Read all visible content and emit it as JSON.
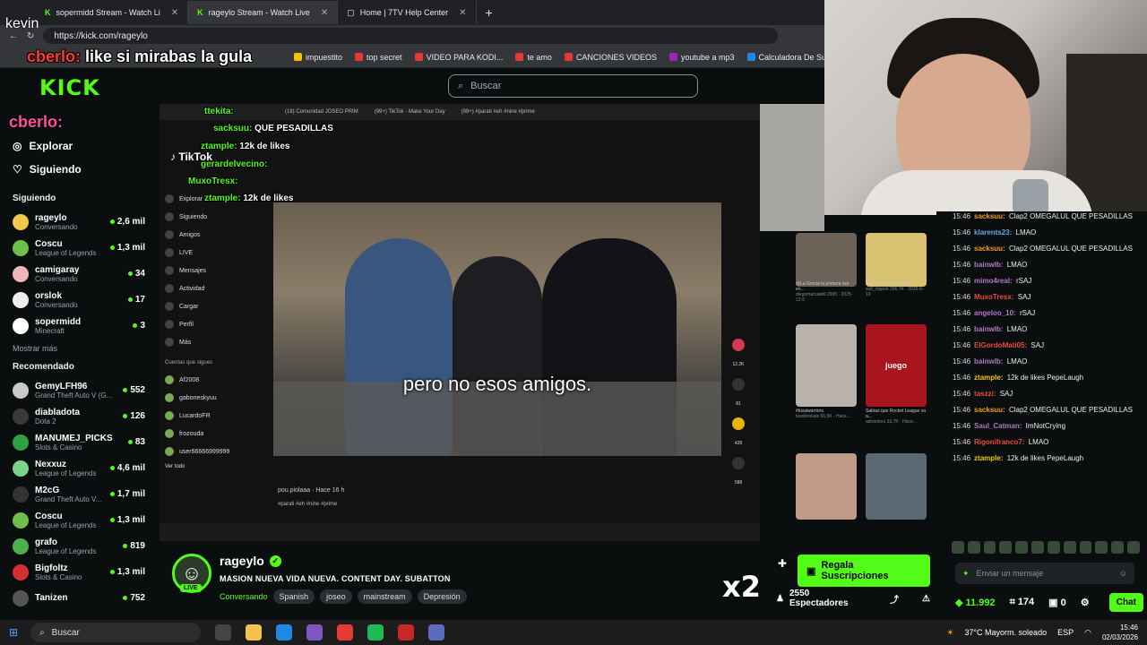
{
  "browser": {
    "tabs": [
      {
        "label": "sopermidd Stream - Watch Li"
      },
      {
        "label": "rageylo Stream - Watch Live"
      },
      {
        "label": "Home | 7TV Help Center"
      }
    ],
    "url": "https://kick.com/rageylo",
    "bookmarks": [
      "impuestito",
      "top secret",
      "VIDEO PARA KODI...",
      "te amo",
      "CANCIONES VIDEOS",
      "youtube a mp3",
      "Calculadora De Su..."
    ]
  },
  "kick": {
    "logo": "KICK",
    "search_placeholder": "Buscar",
    "nav": {
      "explore": "Explorar",
      "following": "Siguiendo"
    },
    "following_title": "Siguiendo",
    "following": [
      {
        "name": "rageylo",
        "cat": "Conversando",
        "viewers": "2,6 mil",
        "color": "#f2c94c"
      },
      {
        "name": "Coscu",
        "cat": "League of Legends",
        "viewers": "1,3 mil",
        "color": "#6fbf4a"
      },
      {
        "name": "camigaray",
        "cat": "Conversando",
        "viewers": "34",
        "color": "#f3b6b6"
      },
      {
        "name": "orslok",
        "cat": "Conversando",
        "viewers": "17",
        "color": "#eeeeee"
      },
      {
        "name": "sopermidd",
        "cat": "Minecraft",
        "viewers": "3",
        "color": "#ffffff"
      }
    ],
    "show_more": "Mostrar más",
    "recommended_title": "Recomendado",
    "recommended": [
      {
        "name": "GemyLFH96",
        "cat": "Grand Theft Auto V (G...",
        "viewers": "552",
        "color": "#c9c9c9"
      },
      {
        "name": "diabladota",
        "cat": "Dota 2",
        "viewers": "126",
        "color": "#3a3a3a"
      },
      {
        "name": "MANUMEJ_PICKS",
        "cat": "Slots & Casino",
        "viewers": "83",
        "color": "#2f9e44"
      },
      {
        "name": "Nexxuz",
        "cat": "League of Legends",
        "viewers": "4,6 mil",
        "color": "#7bd389"
      },
      {
        "name": "M2cG",
        "cat": "Grand Theft Auto V...",
        "viewers": "1,7 mil",
        "color": "#333333"
      },
      {
        "name": "Coscu",
        "cat": "League of Legends",
        "viewers": "1,3 mil",
        "color": "#6fbf4a"
      },
      {
        "name": "grafo",
        "cat": "League of Legends",
        "viewers": "819",
        "color": "#4caf50"
      },
      {
        "name": "Bigfoltz",
        "cat": "Slots & Casino",
        "viewers": "1,3 mil",
        "color": "#d32f2f"
      },
      {
        "name": "Tanizen",
        "cat": "",
        "viewers": "752",
        "color": "#555555"
      }
    ]
  },
  "video": {
    "inner_tabs": [
      "(18) Comunidad JOSEO PRIM",
      "(99+) TikTok - Make Your Day",
      "(99+) #parati #eh #nine #prime"
    ],
    "tiktok_logo": "TikTok",
    "tiktok_nav": [
      "Explorar",
      "Siguiendo",
      "Amigos",
      "LIVE",
      "Mensajes",
      "Actividad",
      "Cargar",
      "Perfil",
      "Más"
    ],
    "following_accounts_title": "Cuentas que sigues",
    "following_accounts": [
      "Af2008",
      "gaboneskyuu",
      "LucardoFR",
      "frozouda",
      "user66666999999"
    ],
    "see_all": "Ver todo",
    "caption": "pero no esos amigos.",
    "uploader": "pou.piolaaa · Hace 16 h",
    "hashtags": "#parati #eh #nine #prime",
    "side_counts": [
      "12.2K",
      "81",
      "428",
      "588"
    ],
    "thumbs": [
      {
        "label": "@La Grecia la primera vez en...",
        "meta": "diegomarcatelli  2905 · 2025-12-5"
      },
      {
        "label": "tum_tum paaa #paratii...",
        "meta": "sofi_nippon  296,7K · 2025-9-10"
      },
      {
        "label": "#tussiwarriors",
        "meta": "tussitonkais  56,5K · Hace..."
      },
      {
        "label": "Sabías que Rocket League va a...",
        "meta": "adriantors  33,7K · Hace..."
      }
    ],
    "thumb_word": "juego"
  },
  "overlays": {
    "kevin": "kevin",
    "top_name": "cberlo:",
    "top_text": "like si mirabas la gula",
    "mid": "cberlo:",
    "screen_chat": [
      {
        "user": "ttekita:",
        "text": ""
      },
      {
        "user": "sacksuu:",
        "text": "QUE PESADILLAS"
      },
      {
        "user": "ztample:",
        "text": "12k de likes"
      },
      {
        "user": "gerardelvecino:",
        "text": ""
      },
      {
        "user": "MuxoTresx:",
        "text": ""
      },
      {
        "user": "ztample:",
        "text": "12k de likes"
      }
    ],
    "x2": "x2"
  },
  "chat": {
    "messages": [
      {
        "time": "15:46",
        "user": "sacksuu:",
        "text": "Clap2 OMEGALUL QUE PESADILLAS",
        "color": "#f39c12"
      },
      {
        "time": "15:46",
        "user": "klarents23:",
        "text": "LMAO",
        "color": "#5dade2"
      },
      {
        "time": "15:46",
        "user": "sacksuu:",
        "text": "Clap2 OMEGALUL QUE PESADILLAS",
        "color": "#f39c12"
      },
      {
        "time": "15:46",
        "user": "bainwlb:",
        "text": "LMAO",
        "color": "#af7ac5"
      },
      {
        "time": "15:46",
        "user": "mimo4real:",
        "text": "rSAJ",
        "color": "#af7ac5"
      },
      {
        "time": "15:46",
        "user": "MuxoTresx:",
        "text": "SAJ",
        "color": "#e74c3c"
      },
      {
        "time": "15:46",
        "user": "angeloo_10:",
        "text": "rSAJ",
        "color": "#af7ac5"
      },
      {
        "time": "15:46",
        "user": "bainwlb:",
        "text": "LMAO",
        "color": "#af7ac5"
      },
      {
        "time": "15:46",
        "user": "ElGordoMati05:",
        "text": "SAJ",
        "color": "#e74c3c"
      },
      {
        "time": "15:46",
        "user": "bainwlb:",
        "text": "LMAO",
        "color": "#af7ac5"
      },
      {
        "time": "15:46",
        "user": "ztample:",
        "text": "12k de likes PepeLaugh",
        "color": "#f1c40f"
      },
      {
        "time": "15:46",
        "user": "taszzi:",
        "text": "SAJ",
        "color": "#e74c3c"
      },
      {
        "time": "15:46",
        "user": "sacksuu:",
        "text": "Clap2 OMEGALUL QUE PESADILLAS",
        "color": "#f39c12"
      },
      {
        "time": "15:46",
        "user": "Saul_Catman:",
        "text": "ImNotCrying",
        "color": "#af7ac5"
      },
      {
        "time": "15:46",
        "user": "Rigonifranco7:",
        "text": "LMAO",
        "color": "#e74c3c"
      },
      {
        "time": "15:46",
        "user": "ztample:",
        "text": "12k de likes PepeLaugh",
        "color": "#f1c40f"
      }
    ],
    "input_placeholder": "Enviar un mensaje",
    "points": "11.992",
    "count": "174",
    "zero": "0",
    "chat_button": "Chat"
  },
  "channel": {
    "name": "rageylo",
    "live": "LIVE",
    "title": "MASION NUEVA VIDA NUEVA. CONTENT DAY. SUBATTON",
    "category": "Conversando",
    "tags": [
      "Spanish",
      "joseo",
      "mainstream",
      "Depresión"
    ],
    "subs_button": "Regala Suscripciones",
    "viewers": "2550 Espectadores"
  },
  "taskbar": {
    "search": "Buscar",
    "weather": "37°C  Mayorm. soleado",
    "lang": "ESP",
    "time": "15:46",
    "date": "02/03/2026"
  }
}
